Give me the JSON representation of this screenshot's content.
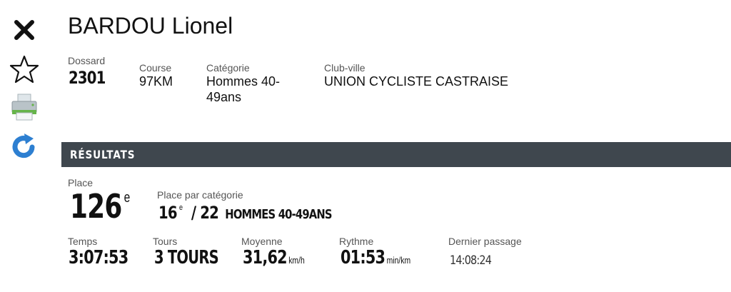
{
  "athlete": {
    "name": "BARDOU Lionel"
  },
  "icons": {
    "close": "close-icon",
    "favorite": "star-icon",
    "print": "printer-icon",
    "refresh": "refresh-icon"
  },
  "info": {
    "dossard_label": "Dossard",
    "dossard_value": "2301",
    "course_label": "Course",
    "course_value": "97KM",
    "categorie_label": "Catégorie",
    "categorie_value_line1": "Hommes 40-",
    "categorie_value_line2": "49ans",
    "club_label": "Club-ville",
    "club_value": "UNION CYCLISTE CASTRAISE"
  },
  "results": {
    "section_title": "RÉSULTATS",
    "place_label": "Place",
    "place_value": "126",
    "place_suffix": "e",
    "cat_place_label": "Place par catégorie",
    "cat_place_value": "16",
    "cat_place_suffix": "e",
    "cat_total": "/ 22",
    "cat_name": "HOMMES 40-49ANS",
    "temps_label": "Temps",
    "temps_value": "3:07:53",
    "tours_label": "Tours",
    "tours_value": "3 TOURS",
    "moyenne_label": "Moyenne",
    "moyenne_value": "31,62",
    "moyenne_unit": "km/h",
    "rythme_label": "Rythme",
    "rythme_value": "01:53",
    "rythme_unit": "min/km",
    "dernier_label": "Dernier passage",
    "dernier_value": "14:08:24"
  },
  "colors": {
    "section_bar": "#3f474e",
    "refresh_blue": "#2d7fd1",
    "printer_green": "#66b44a"
  }
}
